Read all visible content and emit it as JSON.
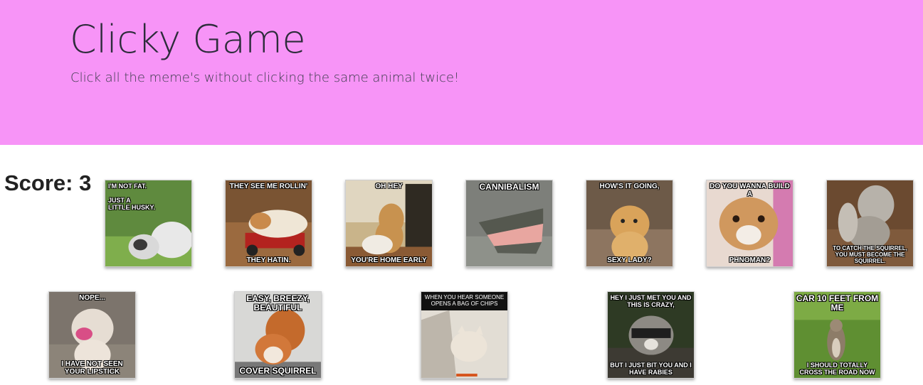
{
  "header": {
    "title": "Clicky Game",
    "subtitle": "Click all the meme's without clicking the same animal twice!"
  },
  "score": {
    "label": "Score: 3"
  },
  "cards": [
    {
      "animal": "husky",
      "top_text": "I'M NOT FAT.\n\nJUST A\nLITTLE HUSKY.",
      "bottom_text": ""
    },
    {
      "animal": "guinea-pig",
      "top_text": "THEY SEE ME ROLLIN'",
      "bottom_text": "THEY HATIN."
    },
    {
      "animal": "pug",
      "top_text": "OH HEY",
      "bottom_text": "YOU'RE HOME EARLY"
    },
    {
      "animal": "alligator",
      "top_text": "CANNIBALISM",
      "bottom_text": ""
    },
    {
      "animal": "puppy",
      "top_text": "HOW'S IT GOING,",
      "bottom_text": "SEXY LADY?"
    },
    {
      "animal": "chihuahua",
      "top_text": "DO YOU WANNA BUILD A",
      "bottom_text": "PHNOMAN?"
    },
    {
      "animal": "squirrel-dog",
      "top_text": "",
      "bottom_text": "TO CATCH THE SQUIRREL, YOU MUST BECOME THE SQUIRREL."
    },
    {
      "animal": "shih-tzu",
      "top_text": "NOPE...",
      "bottom_text": "I HAVE NOT SEEN YOUR LIPSTICK"
    },
    {
      "animal": "squirrel",
      "top_text": "EASY, BREEZY, BEAUTIFUL",
      "bottom_text": "COVER SQUIRREL"
    },
    {
      "animal": "dog-in-box",
      "top_text": "When you hear someone opens a bag of chips",
      "bottom_text": ""
    },
    {
      "animal": "raccoon",
      "top_text": "HEY I JUST MET YOU AND THIS IS CRAZY,",
      "bottom_text": "BUT I JUST BIT YOU AND I HAVE RABIES"
    },
    {
      "animal": "squirrel-standing",
      "top_text": "CAR 10 FEET FROM ME",
      "bottom_text": "I SHOULD TOTALLY CROSS THE ROAD NOW"
    }
  ]
}
